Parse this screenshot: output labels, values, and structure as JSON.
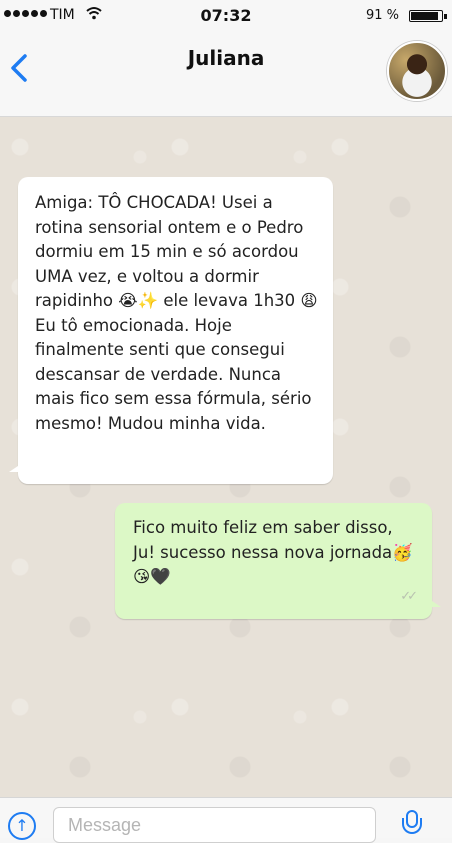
{
  "status_bar": {
    "carrier": "TIM",
    "time": "07:32",
    "battery_percent": "91 %",
    "battery_level": 0.91,
    "wifi_icon": "wifi-icon",
    "signal_icon": "signal-dots-icon"
  },
  "header": {
    "contact_name": "Juliana",
    "back_icon": "chevron-left-icon",
    "avatar": "contact-avatar"
  },
  "messages": [
    {
      "direction": "incoming",
      "text": "Amiga: TÔ CHOCADA! Usei a rotina sensorial ontem e o Pedro dormiu em 15 min e só acordou UMA vez, e voltou a dormir rapidinho 😭✨ ele levava 1h30 😩 Eu tô emocionada. Hoje finalmente senti que consegui descansar de verdade. Nunca mais fico sem essa fórmula, sério mesmo! Mudou minha vida."
    },
    {
      "direction": "outgoing",
      "text": "Fico muito feliz em saber disso, Ju! sucesso nessa nova jornada🥳 😘🖤",
      "status_icon": "double-check-icon"
    }
  ],
  "input_bar": {
    "placeholder": "Message",
    "value": "",
    "upload_icon": "upload-icon",
    "mic_icon": "microphone-icon"
  },
  "colors": {
    "accent": "#1e7cf2",
    "outgoing_bubble": "#dcf8c6",
    "incoming_bubble": "#ffffff",
    "chat_background": "#e7e1d8"
  }
}
